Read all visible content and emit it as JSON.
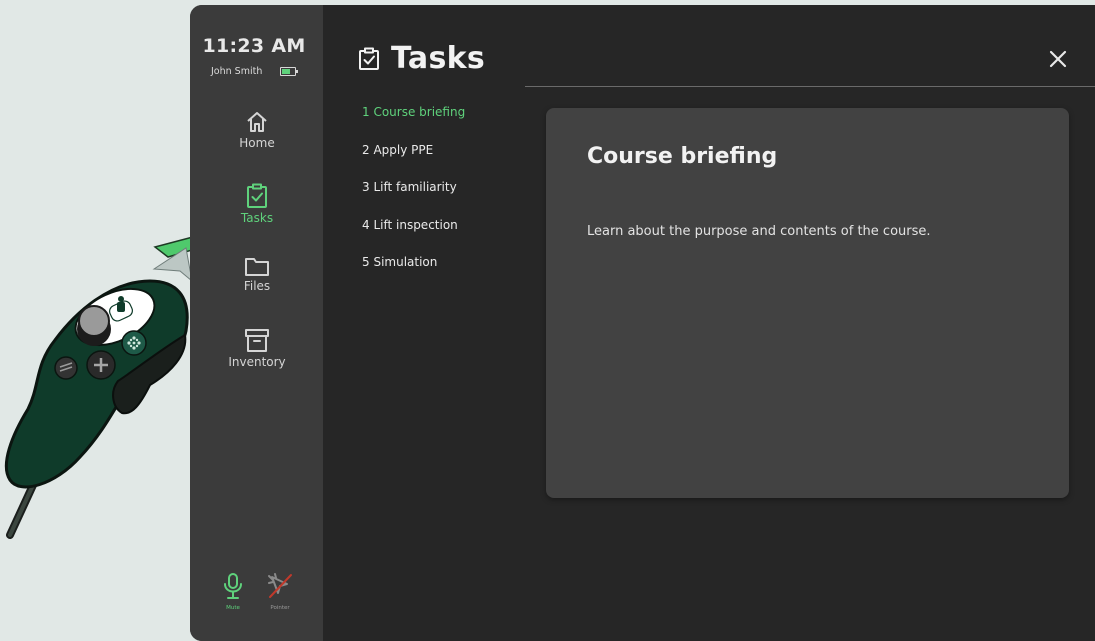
{
  "status": {
    "time": "11:23 AM",
    "user": "John Smith",
    "battery_level": 0.65
  },
  "nav": {
    "items": [
      {
        "label": "Home",
        "icon": "home-icon"
      },
      {
        "label": "Tasks",
        "icon": "clipboard-check-icon",
        "active": true
      },
      {
        "label": "Files",
        "icon": "folder-icon"
      },
      {
        "label": "Inventory",
        "icon": "archive-box-icon"
      }
    ]
  },
  "tools": {
    "mute_label": "Mute",
    "pointer_label": "Pointer"
  },
  "header": {
    "title": "Tasks",
    "title_icon": "clipboard-check-icon",
    "close_icon": "close-icon"
  },
  "tasks": [
    {
      "label": "1 Course briefing",
      "active": true
    },
    {
      "label": "2 Apply PPE"
    },
    {
      "label": "3 Lift familiarity"
    },
    {
      "label": "4 Lift inspection"
    },
    {
      "label": "5 Simulation"
    }
  ],
  "detail": {
    "title": "Course briefing",
    "description": "Learn about the purpose and contents of the course."
  },
  "colors": {
    "accent": "#5fd27c",
    "sidebar_bg": "#3b3b3b",
    "panel_bg": "#262626",
    "card_bg": "#424242",
    "backdrop": "#e1e8e6"
  }
}
